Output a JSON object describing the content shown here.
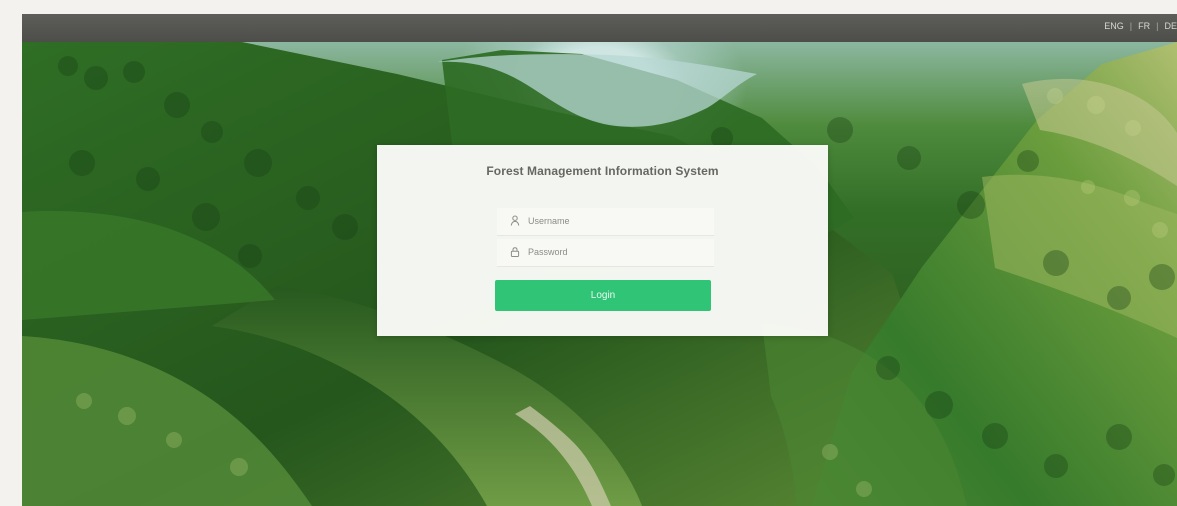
{
  "top_bar": {
    "languages": [
      "ENG",
      "FR",
      "DE"
    ],
    "separators": [
      "|",
      "|"
    ]
  },
  "login": {
    "title": "Forest Management Information System",
    "username_placeholder": "Username",
    "password_placeholder": "Password",
    "button_label": "Login"
  },
  "icons": {
    "username": "user-icon",
    "password": "lock-icon"
  },
  "colors": {
    "top_bar": "#545450",
    "panel": "#fafaf7",
    "button": "#2fc476",
    "title": "#676762"
  }
}
